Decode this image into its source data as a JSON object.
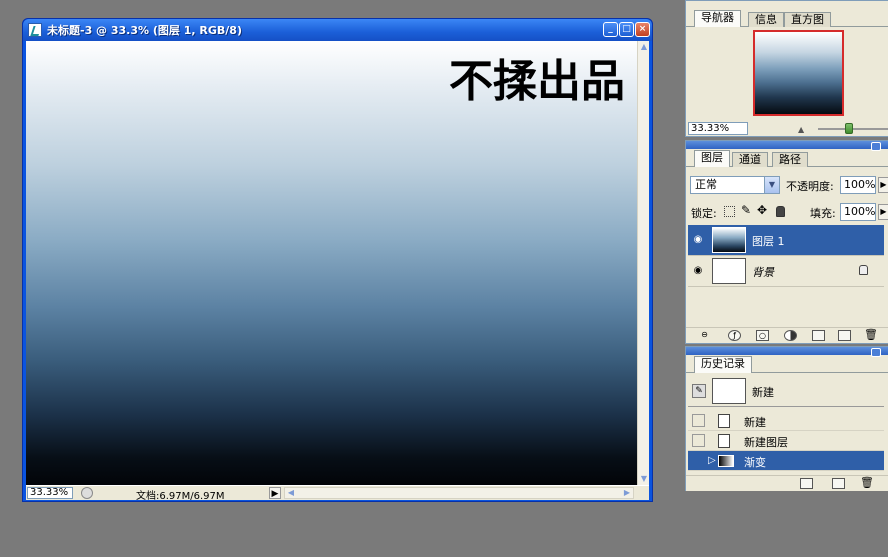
{
  "document_window": {
    "title": "未标题-3 @ 33.3% (图层 1, RGB/8)",
    "canvas_text": "不揉出品",
    "status": {
      "zoom": "33.33%",
      "doc_info": "文档:6.97M/6.97M"
    }
  },
  "navigator_panel": {
    "tabs": [
      "导航器",
      "信息",
      "直方图"
    ],
    "active_tab": "导航器",
    "zoom": "33.33%"
  },
  "layers_panel": {
    "tabs": [
      "图层",
      "通道",
      "路径"
    ],
    "active_tab": "图层",
    "blend_mode": "正常",
    "opacity_label": "不透明度:",
    "opacity_value": "100%",
    "lock_label": "锁定:",
    "fill_label": "填充:",
    "fill_value": "100%",
    "layers": [
      {
        "name": "图层 1",
        "selected": true
      },
      {
        "name": "背景",
        "selected": false,
        "locked": true
      }
    ]
  },
  "history_panel": {
    "title": "历史记录",
    "snapshot_name": "新建",
    "items": [
      {
        "name": "新建",
        "selected": false
      },
      {
        "name": "新建图层",
        "selected": false
      },
      {
        "name": "渐变",
        "selected": true
      }
    ]
  },
  "colors": {
    "titlebar": "#1b5fd8",
    "selection": "#2f5fa8",
    "panel_bg": "#ece9d8",
    "workspace": "#7a7a7a"
  }
}
